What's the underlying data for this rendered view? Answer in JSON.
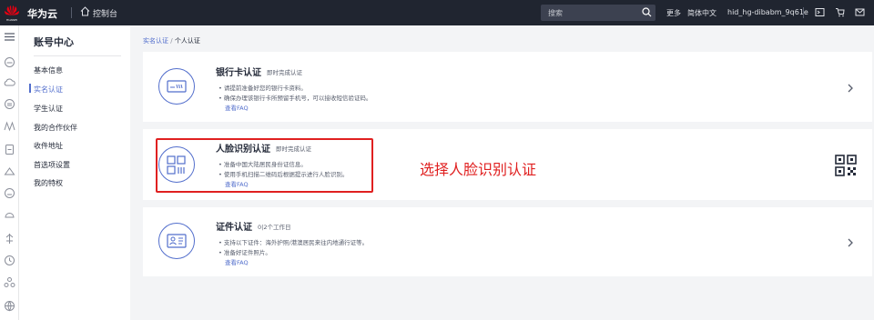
{
  "header": {
    "brand": "华为云",
    "console": "控制台",
    "search_placeholder": "搜索",
    "more": "更多",
    "lang": "简体中文",
    "username": "hid_hg-dibabm_9q61e",
    "logo_text": "HUAWEI"
  },
  "sidebar": {
    "title": "账号中心",
    "items": [
      {
        "label": "基本信息"
      },
      {
        "label": "实名认证"
      },
      {
        "label": "学生认证"
      },
      {
        "label": "我的合作伙伴"
      },
      {
        "label": "收件地址"
      },
      {
        "label": "首选项设置"
      },
      {
        "label": "我的特权"
      }
    ],
    "active_index": 1
  },
  "breadcrumb": {
    "parent": "实名认证",
    "sep": "/",
    "current": "个人认证"
  },
  "cards": [
    {
      "title": "银行卡认证",
      "subtitle": "即时完成认证",
      "bullets": [
        "• 请提前准备好您的银行卡资料。",
        "• 确保办理该银行卡所预留手机号，可以接收短信验证码。"
      ],
      "faq": "查看FAQ",
      "icon": "bank-card-icon"
    },
    {
      "title": "人脸识别认证",
      "subtitle": "即时完成认证",
      "bullets": [
        "• 准备中国大陆居民身份证信息。",
        "• 使用手机扫描二维码后根据提示进行人脸识别。"
      ],
      "faq": "查看FAQ",
      "icon": "face-recognition-icon"
    },
    {
      "title": "证件认证",
      "subtitle": "0|2个工作日",
      "bullets": [
        "• 支持以下证件：海外护照/港澳居民来往内地通行证等。",
        "• 准备好证件照片。"
      ],
      "faq": "查看FAQ",
      "icon": "id-document-icon"
    }
  ],
  "annotation": "选择人脸识别认证",
  "colors": {
    "accent": "#526ecc",
    "highlight": "#e02020",
    "topbar": "#202530"
  }
}
